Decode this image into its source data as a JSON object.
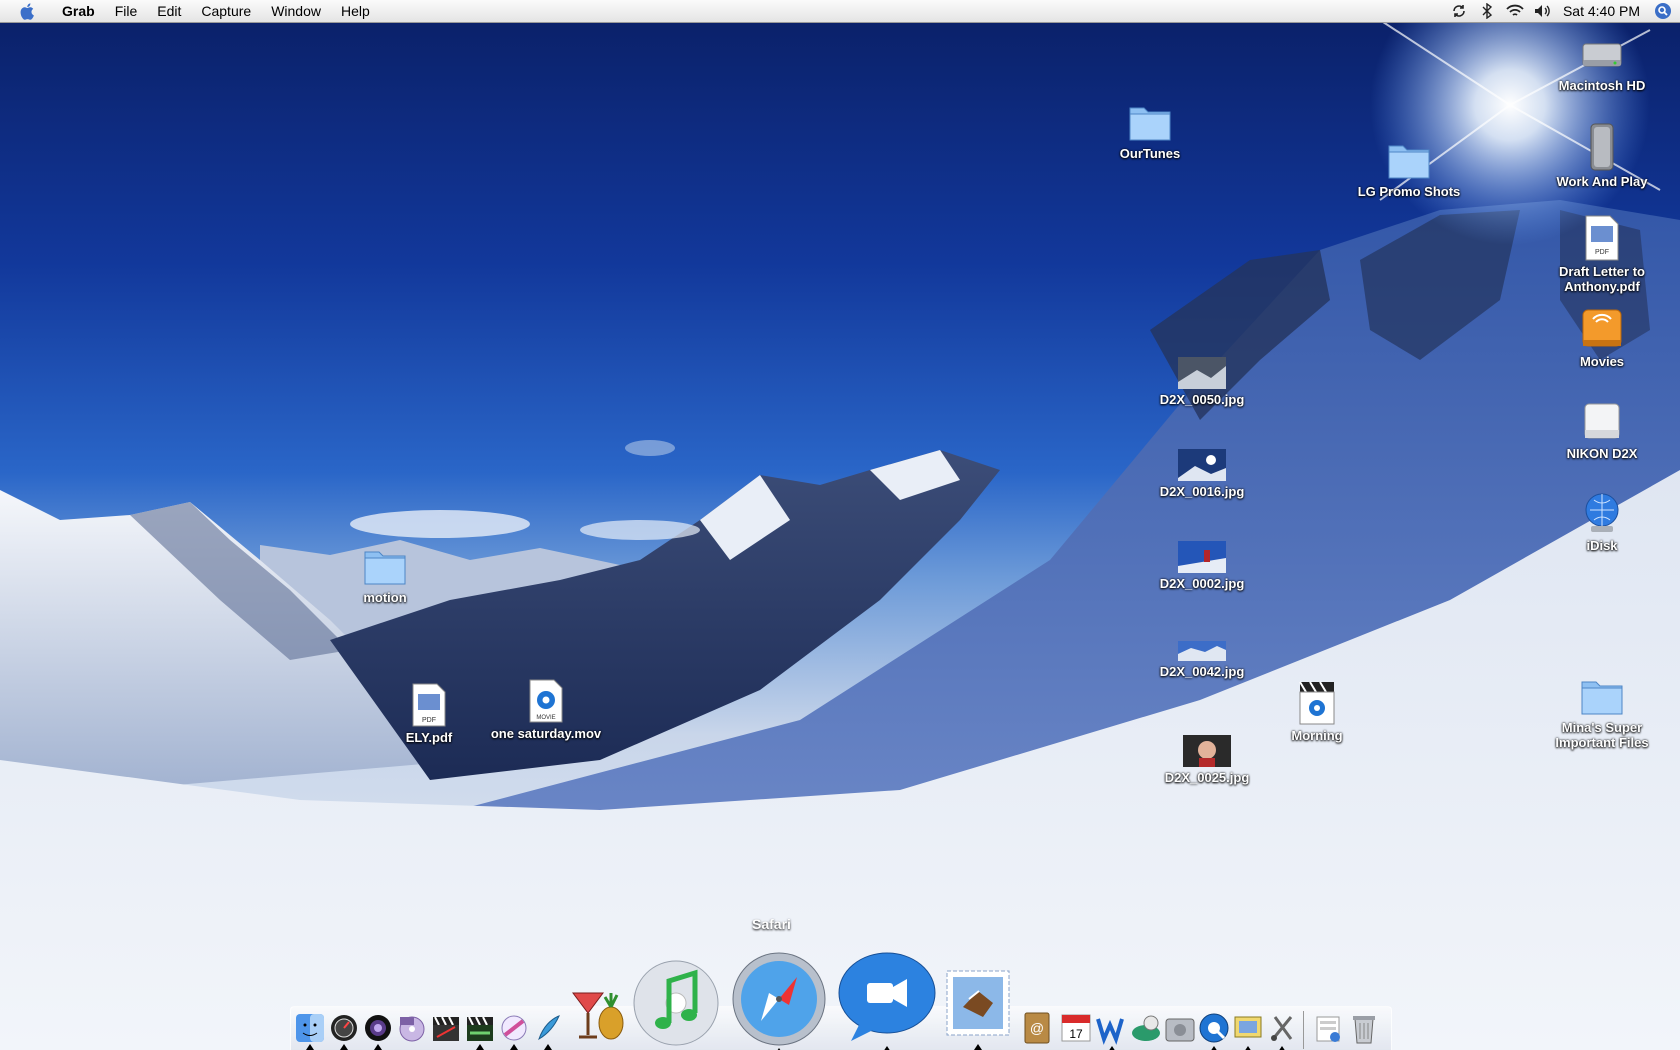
{
  "menubar": {
    "apple_icon": "apple-icon",
    "app_name": "Grab",
    "menus": [
      "File",
      "Edit",
      "Capture",
      "Window",
      "Help"
    ],
    "extras": [
      "sync-icon",
      "bluetooth-icon",
      "wifi-icon",
      "volume-icon"
    ],
    "clock": "Sat 4:40 PM",
    "spotlight_icon": "spotlight-icon"
  },
  "desktop_icons": {
    "macintosh_hd": "Macintosh HD",
    "work_and_play": "Work And Play",
    "draft_letter": "Draft Letter to Anthony.pdf",
    "movies": "Movies",
    "nikon_d2x": "NIKON D2X",
    "idisk": "iDisk",
    "minas_files": "Mina's Super Important Files",
    "ourtunes": "OurTunes",
    "lg_promo": "LG Promo Shots",
    "d2x_0050": "D2X_0050.jpg",
    "d2x_0016": "D2X_0016.jpg",
    "d2x_0002": "D2X_0002.jpg",
    "d2x_0042": "D2X_0042.jpg",
    "d2x_0025": "D2X_0025.jpg",
    "morning": "Morning",
    "motion": "motion",
    "ely_pdf": "ELY.pdf",
    "one_saturday": "one saturday.mov"
  },
  "dock": {
    "tooltip": "Safari",
    "items": [
      "finder-icon",
      "dashboard-icon",
      "aperture-icon",
      "dvd-studio-icon",
      "final-cut-icon",
      "motion-app-icon",
      "color-icon",
      "feather-icon",
      "cocktail-icon",
      "itunes-icon",
      "safari-icon",
      "ichat-icon",
      "mail-icon",
      "address-book-icon",
      "ical-icon",
      "word-icon",
      "fetch-icon",
      "system-prefs-icon",
      "quicktime-icon",
      "preview-icon",
      "utilities-icon",
      "documents-stack-icon",
      "trash-icon"
    ]
  },
  "colors": {
    "sky": "#12389b",
    "snow": "#eef2f8",
    "label_text": "#ffffff"
  }
}
